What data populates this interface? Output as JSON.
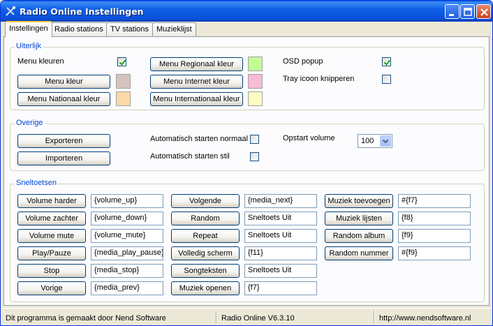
{
  "window": {
    "title": "Radio Online Instellingen"
  },
  "tabs": [
    {
      "label": "Instellingen",
      "active": true
    },
    {
      "label": "Radio stations",
      "active": false
    },
    {
      "label": "TV stations",
      "active": false
    },
    {
      "label": "Muzieklijst",
      "active": false
    }
  ],
  "uiterlijk": {
    "legend": "Uiterlijk",
    "menu_kleuren_label": "Menu kleuren",
    "menu_kleuren_checked": true,
    "buttons": {
      "menu_kleur": "Menu kleur",
      "menu_nationaal": "Menu Nationaal kleur",
      "menu_regionaal": "Menu Regionaal kleur",
      "menu_internet": "Menu Internet kleur",
      "menu_internationaal": "Menu Internationaal kleur"
    },
    "colors": {
      "menu_kleur": "#d4c4bc",
      "menu_nationaal": "#fcd8a8",
      "menu_regionaal": "#c4fc94",
      "menu_internet": "#f8bcd4",
      "menu_internationaal": "#fcfcc4"
    },
    "osd_popup_label": "OSD popup",
    "osd_popup_checked": true,
    "tray_label": "Tray icoon knipperen",
    "tray_checked": false
  },
  "overige": {
    "legend": "Overige",
    "exporteren": "Exporteren",
    "importeren": "Importeren",
    "auto_normaal_label": "Automatisch starten normaal",
    "auto_normaal_checked": false,
    "auto_stil_label": "Automatisch starten stil",
    "auto_stil_checked": false,
    "opstart_volume_label": "Opstart volume",
    "opstart_volume_value": "100"
  },
  "sneltoetsen": {
    "legend": "Sneltoetsen",
    "col1": [
      {
        "label": "Volume harder",
        "value": "{volume_up}"
      },
      {
        "label": "Volume zachter",
        "value": "{volume_down}"
      },
      {
        "label": "Volume mute",
        "value": "{volume_mute}"
      },
      {
        "label": "Play/Pauze",
        "value": "{media_play_pause}"
      },
      {
        "label": "Stop",
        "value": "{media_stop}"
      },
      {
        "label": "Vorige",
        "value": "{media_prev}"
      }
    ],
    "col2": [
      {
        "label": "Volgende",
        "value": "{media_next}"
      },
      {
        "label": "Random",
        "value": "Sneltoets Uit"
      },
      {
        "label": "Repeat",
        "value": "Sneltoets Uit"
      },
      {
        "label": "Volledig scherm",
        "value": "{f11}"
      },
      {
        "label": "Songteksten",
        "value": "Sneltoets Uit"
      },
      {
        "label": "Muziek openen",
        "value": "{f7}"
      }
    ],
    "col3": [
      {
        "label": "Muziek toevoegen",
        "value": "#{f7}"
      },
      {
        "label": "Muziek lijsten",
        "value": "{f8}"
      },
      {
        "label": "Random album",
        "value": "{f9}"
      },
      {
        "label": "Random nummer",
        "value": "#{f9}"
      }
    ]
  },
  "statusbar": {
    "credit": "Dit programma is gemaakt door Nend Software",
    "version": "Radio Online V6.3.10",
    "url": "http://www.nendsoftware.nl"
  }
}
